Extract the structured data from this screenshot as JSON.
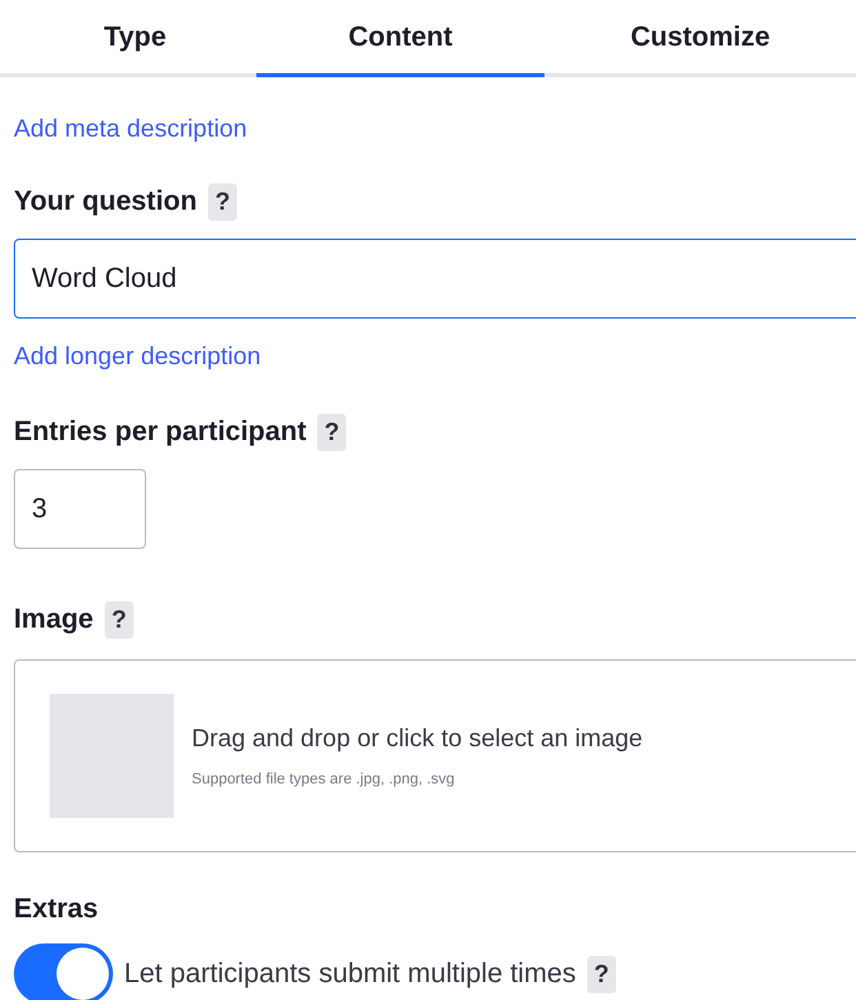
{
  "tabs": [
    {
      "label": "Type",
      "selected": false
    },
    {
      "label": "Content",
      "selected": true
    },
    {
      "label": "Customize",
      "selected": false
    }
  ],
  "meta_link": "Add meta description",
  "question": {
    "label": "Your question",
    "help": "?",
    "value": "Word Cloud"
  },
  "longer_link": "Add longer description",
  "entries": {
    "label": "Entries per participant",
    "help": "?",
    "value": "3"
  },
  "image": {
    "label": "Image",
    "help": "?",
    "prompt": "Drag and drop or click to select an image",
    "hint": "Supported file types are .jpg, .png, .svg"
  },
  "extras": {
    "label": "Extras",
    "options": [
      {
        "label": "Let participants submit multiple times",
        "help": "?",
        "on": true
      }
    ]
  }
}
